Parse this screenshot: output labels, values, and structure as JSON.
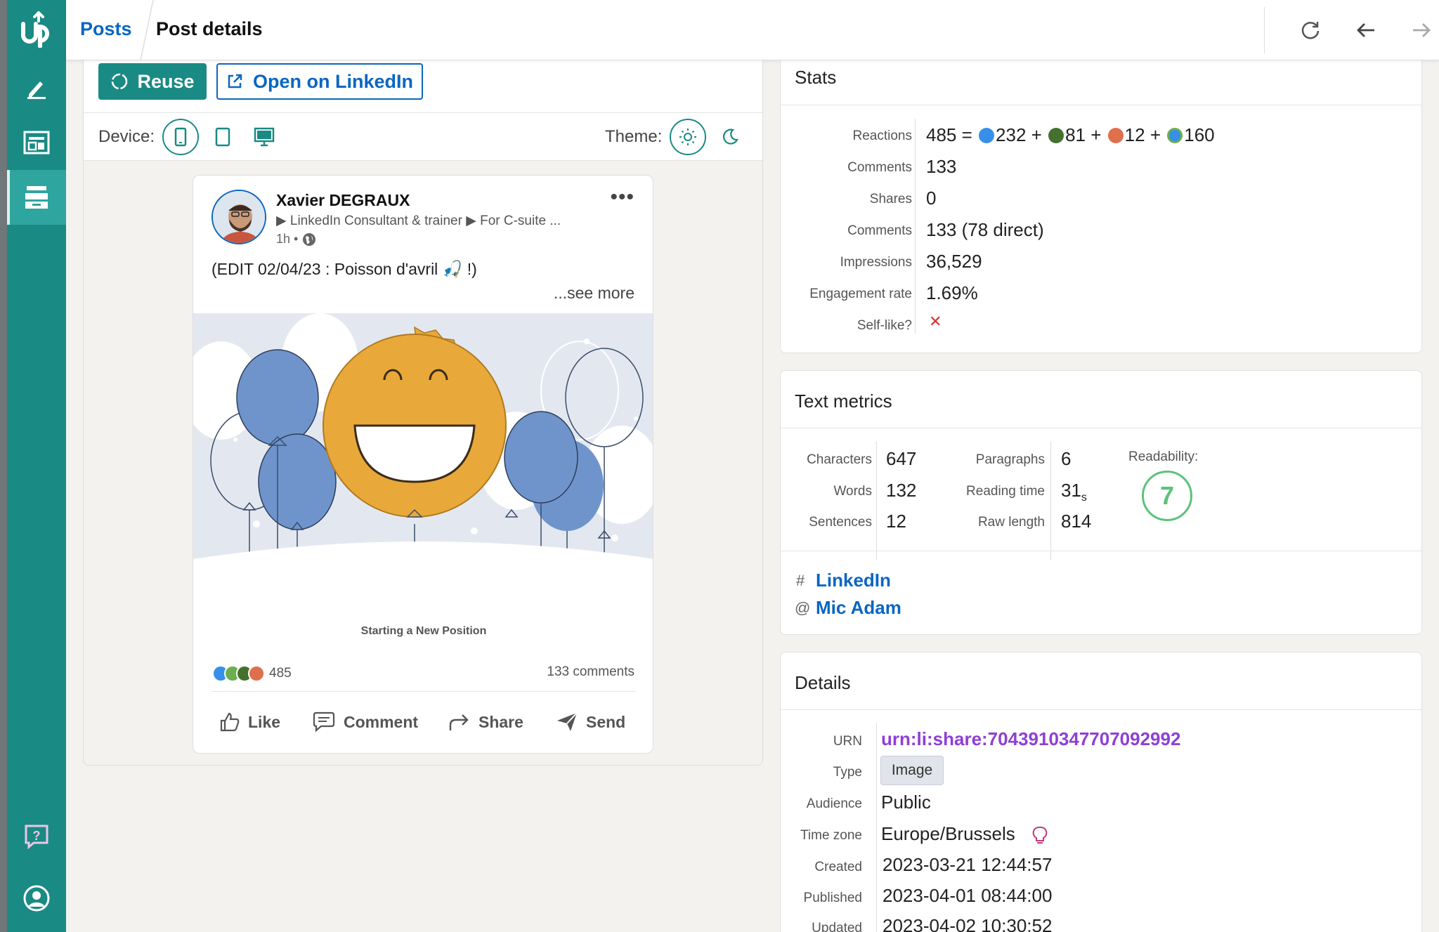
{
  "breadcrumb": {
    "posts": "Posts",
    "current": "Post details"
  },
  "actions": {
    "reuse": "Reuse",
    "open": "Open on LinkedIn"
  },
  "preview": {
    "device_label": "Device:",
    "theme_label": "Theme:"
  },
  "post": {
    "author": "Xavier DEGRAUX",
    "headline": "▶ LinkedIn Consultant & trainer ▶ For C-suite ...",
    "time": "1h •",
    "text": "(EDIT 02/04/23 : Poisson d'avril 🎣 !)",
    "see_more": "...see more",
    "caption": "Starting a New Position",
    "reactions_count": "485",
    "comments_count": "133 comments",
    "buttons": {
      "like": "Like",
      "comment": "Comment",
      "share": "Share",
      "send": "Send"
    }
  },
  "stats": {
    "title": "Stats",
    "rows": [
      {
        "label": "Reactions",
        "value": "485 ="
      },
      {
        "label": "Comments",
        "value": "133"
      },
      {
        "label": "Shares",
        "value": "0"
      },
      {
        "label": "Comments",
        "value": "133 (78 direct)"
      },
      {
        "label": "Impressions",
        "value": "36,529"
      },
      {
        "label": "Engagement rate",
        "value": "1.69%"
      },
      {
        "label": "Self-like?",
        "value": "✕"
      }
    ],
    "reaction_breakdown": [
      {
        "count": "232",
        "color": "#378fe9"
      },
      {
        "count": "81",
        "color": "#44712e"
      },
      {
        "count": "12",
        "color": "#df704d"
      },
      {
        "count": "160",
        "color": "#6dae4f"
      }
    ],
    "plus": "+"
  },
  "text_metrics": {
    "title": "Text metrics",
    "col1": [
      {
        "label": "Characters",
        "value": "647"
      },
      {
        "label": "Words",
        "value": "132"
      },
      {
        "label": "Sentences",
        "value": "12"
      }
    ],
    "col2": [
      {
        "label": "Paragraphs",
        "value": "6"
      },
      {
        "label": "Reading time",
        "value": "31",
        "unit": "s"
      },
      {
        "label": "Raw length",
        "value": "814"
      }
    ],
    "readability_label": "Readability:",
    "readability_value": "7",
    "hashtag_prefix": "#",
    "hashtag": "LinkedIn",
    "mention_prefix": "@",
    "mention": "Mic Adam"
  },
  "details": {
    "title": "Details",
    "urn_label": "URN",
    "urn": "urn:li:share:7043910347707092992",
    "type_label": "Type",
    "type": "Image",
    "audience_label": "Audience",
    "audience": "Public",
    "timezone_label": "Time zone",
    "timezone": "Europe/Brussels",
    "created_label": "Created",
    "created": "2023-03-21 12:44:57",
    "published_label": "Published",
    "published": "2023-04-01 08:44:00",
    "updated_label": "Updated",
    "updated": "2023-04-02 10:30:52"
  },
  "colors": {
    "brand": "#1a8a84",
    "link": "#0a66c2",
    "urn": "#8e3fd6",
    "readability": "#5cc27a"
  }
}
